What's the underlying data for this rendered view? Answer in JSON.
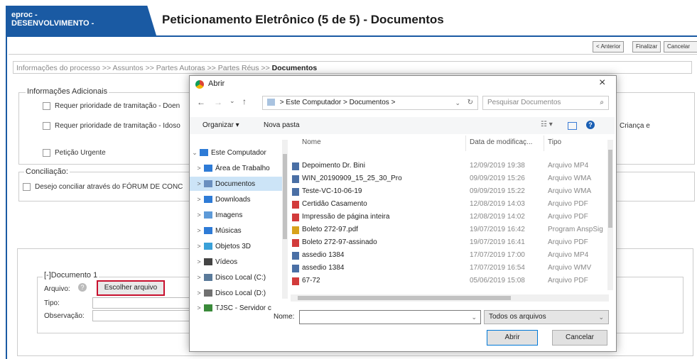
{
  "header": {
    "env_line1": "eproc -",
    "env_line2": "DESENVOLVIMENTO -",
    "title": "Peticionamento Eletrônico (5 de 5) - Documentos"
  },
  "top_buttons": {
    "anterior": "< Anterior",
    "finalizar": "Finalizar",
    "cancelar": "Cancelar"
  },
  "breadcrumb": {
    "steps": [
      "Informações do processo",
      ">>",
      "Assuntos",
      ">>",
      "Partes Autoras",
      ">>",
      "Partes Réus",
      ">>"
    ],
    "current": "Documentos"
  },
  "info_adicionais": {
    "legend": "Informações Adicionais",
    "items": [
      "Requer prioridade de tramitação - Doen",
      "Requer prioridade de tramitação - Idoso",
      "Petição Urgente"
    ],
    "right_text": "Criança e"
  },
  "conciliacao": {
    "legend": "Conciliação:",
    "item": "Desejo conciliar através do FÓRUM DE CONC"
  },
  "documento": {
    "legend": "[-]Documento 1",
    "arquivo_label": "Arquivo:",
    "choose_button": "Escolher arquivo",
    "tipo_label": "Tipo:",
    "observacao_label": "Observação:"
  },
  "dialog": {
    "title": "Abrir",
    "close": "×",
    "address": {
      "path": [
        "Este Computador",
        ">",
        "Documentos",
        ">"
      ]
    },
    "search_placeholder": "Pesquisar Documentos",
    "toolbar": {
      "organize": "Organizar ▾",
      "new_folder": "Nova pasta"
    },
    "nav": [
      {
        "label": "Este Computador",
        "chev": "⌄",
        "icon": "computer-icon",
        "color": "#2e7bd6"
      },
      {
        "label": "Área de Trabalho",
        "chev": ">",
        "icon": "desktop-icon",
        "color": "#2e7bd6"
      },
      {
        "label": "Documentos",
        "chev": ">",
        "icon": "documents-icon",
        "color": "#6a8fbf"
      },
      {
        "label": "Downloads",
        "chev": ">",
        "icon": "download-icon",
        "color": "#2e7bd6"
      },
      {
        "label": "Imagens",
        "chev": ">",
        "icon": "pictures-icon",
        "color": "#5d9ad8"
      },
      {
        "label": "Músicas",
        "chev": ">",
        "icon": "music-icon",
        "color": "#2e7bd6"
      },
      {
        "label": "Objetos 3D",
        "chev": ">",
        "icon": "objects3d-icon",
        "color": "#3aa0d8"
      },
      {
        "label": "Vídeos",
        "chev": ">",
        "icon": "videos-icon",
        "color": "#444444"
      },
      {
        "label": "Disco Local (C:)",
        "chev": ">",
        "icon": "drive-icon",
        "color": "#5a7a9a"
      },
      {
        "label": "Disco Local (D:)",
        "chev": ">",
        "icon": "drive-icon",
        "color": "#707070"
      },
      {
        "label": "TJSC - Servidor c",
        "chev": ">",
        "icon": "network-drive-icon",
        "color": "#3a8a3a"
      }
    ],
    "columns": {
      "name": "Nome",
      "date": "Data de modificaç...",
      "type": "Tipo"
    },
    "files": [
      {
        "name": "Depoimento Dr. Bini",
        "date": "12/09/2019 19:38",
        "type": "Arquivo MP4",
        "icon": "video-file-icon",
        "color": "#4a6fa5"
      },
      {
        "name": "WIN_20190909_15_25_30_Pro",
        "date": "09/09/2019 15:26",
        "type": "Arquivo WMA",
        "icon": "audio-file-icon",
        "color": "#4a6fa5"
      },
      {
        "name": "Teste-VC-10-06-19",
        "date": "09/09/2019 15:22",
        "type": "Arquivo WMA",
        "icon": "audio-file-icon",
        "color": "#4a6fa5"
      },
      {
        "name": "Certidão Casamento",
        "date": "12/08/2019 14:03",
        "type": "Arquivo PDF",
        "icon": "pdf-file-icon",
        "color": "#d23b3b"
      },
      {
        "name": "Impressão de página inteira",
        "date": "12/08/2019 14:02",
        "type": "Arquivo PDF",
        "icon": "pdf-file-icon",
        "color": "#d23b3b"
      },
      {
        "name": "Boleto 272-97.pdf",
        "date": "19/07/2019 16:42",
        "type": "Program AnspSig",
        "icon": "program-file-icon",
        "color": "#d8a21b"
      },
      {
        "name": "Boleto 272-97-assinado",
        "date": "19/07/2019 16:41",
        "type": "Arquivo PDF",
        "icon": "pdf-file-icon",
        "color": "#d23b3b"
      },
      {
        "name": "assedio 1384",
        "date": "17/07/2019 17:00",
        "type": "Arquivo MP4",
        "icon": "video-file-icon",
        "color": "#4a6fa5"
      },
      {
        "name": "assedio 1384",
        "date": "17/07/2019 16:54",
        "type": "Arquivo WMV",
        "icon": "video-file-icon",
        "color": "#4a6fa5"
      },
      {
        "name": "67-72",
        "date": "05/06/2019 15:08",
        "type": "Arquivo PDF",
        "icon": "pdf-file-icon",
        "color": "#d23b3b"
      }
    ],
    "filename_label": "Nome:",
    "filename_value": "",
    "filter": "Todos os arquivos",
    "open_button": "Abrir",
    "cancel_button": "Cancelar"
  }
}
